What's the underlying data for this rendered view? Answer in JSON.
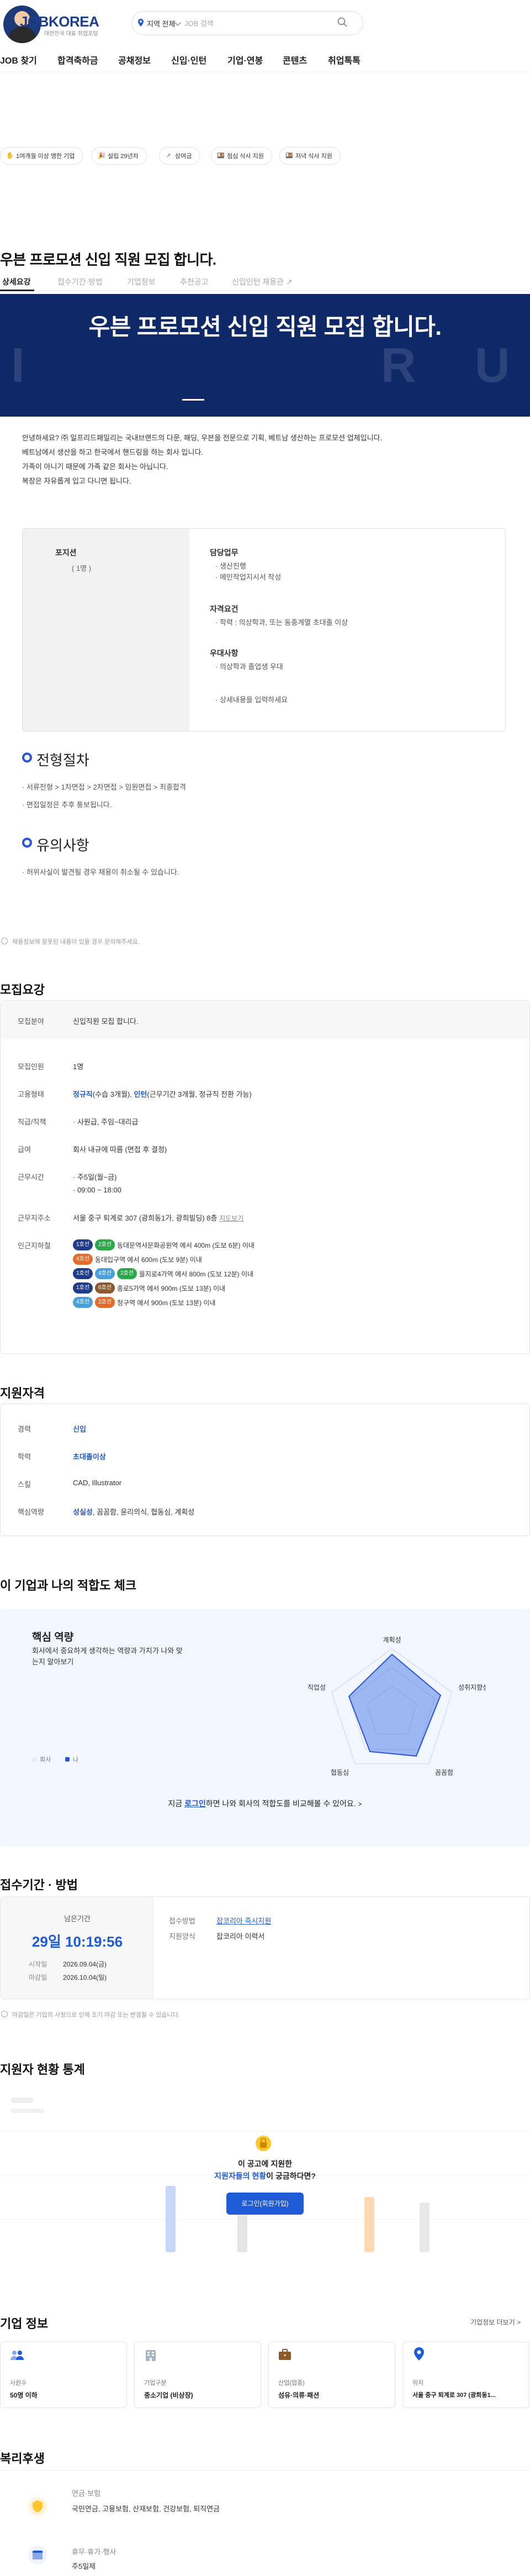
{
  "header": {
    "logo_text": "JOBKOREA",
    "logo_sub": "대한민국 대표 취업포털",
    "location_label": "지역 전체",
    "search_placeholder": "JOB 검색"
  },
  "nav": [
    {
      "label": "JOB 찾기"
    },
    {
      "label": "합격축하금"
    },
    {
      "label": "공채정보"
    },
    {
      "label": "신입·인턴"
    },
    {
      "label": "기업·연봉"
    },
    {
      "label": "콘텐츠"
    },
    {
      "label": "취업톡톡"
    }
  ],
  "chips": [
    {
      "icon": "✋",
      "label": "1여개월 이상 맹한 기업"
    },
    {
      "icon": "🎉",
      "label": "설립 29년차"
    },
    {
      "icon": "↗",
      "label": "상여금"
    },
    {
      "icon": "🍱",
      "label": "점심 식사 지원"
    },
    {
      "icon": "🍱",
      "label": "저녁 식사 지원"
    }
  ],
  "job": {
    "title": "우븐 프로모션 신입 직원 모집 합니다.",
    "tabs": [
      {
        "label": "상세요강"
      },
      {
        "label": "접수기간·방법"
      },
      {
        "label": "기업정보"
      },
      {
        "label": "추천공고"
      },
      {
        "label": "신입인턴 채용관 ↗"
      }
    ],
    "banner_title": "우븐 프로모션 신입 직원 모집 합니다.",
    "intro": [
      "안녕하세요? ㈜ 일프리드패밀리는 국내브랜드의 다운, 패딩, 우븐을 전문으로 기획, 베트남 생산하는 프로모션 업체입니다.",
      "베트남에서 생산을 하고 한국에서 핸드링을 하는 회사 입니다.",
      "가족이 아니기 때문에 가족 같은 회사는 아닙니다.",
      "복장은 자유롭게 입고 다니면 됩니다."
    ],
    "position": {
      "name": "포지션",
      "count": "( 1명 )",
      "sections": [
        {
          "heading": "담당업무",
          "items": [
            "생산진행",
            "메인작업지시서 작성"
          ]
        },
        {
          "heading": "자격요건",
          "items": [
            "학력 : 의상학과, 또는 동종계열 초대졸 이상"
          ]
        },
        {
          "heading": "우대사항",
          "items": [
            "의상학과 졸업생 우대"
          ]
        },
        {
          "heading": "",
          "items": [
            "상세내용을 입력하세요"
          ]
        }
      ]
    },
    "process_title": "전형절차",
    "process_lines": [
      "서류전형 > 1차면접 > 2차면접 > 임원면접 > 최종합격",
      "면접일정은 추후 통보됩니다."
    ],
    "caution_title": "유의사항",
    "caution_lines": [
      "허위사실이 발견될 경우 채용이 취소될 수 있습니다."
    ],
    "note": "채용정보에 잘못된 내용이 있을 경우 문의해주세요."
  },
  "recruit": {
    "title": "모집요강",
    "field_label": "모집분야",
    "field_value": "신입직원 모집 합니다.",
    "headcount_label": "모집인원",
    "headcount_value": "1명",
    "emp_label": "고용형태",
    "emp_value_1": "정규직",
    "emp_value_1_note": "(수습 3개월),",
    "emp_value_2": "인턴",
    "emp_value_2_note": "(근무기간 3개월, 정규직 전환 가능)",
    "rank_label": "직급/직책",
    "rank_value": "사원급, 주임~대리급",
    "salary_label": "급여",
    "salary_value": "회사 내규에 따름 (면접 후 결정)",
    "hours_label": "근무시간",
    "hours_value_1": "주5일(월~금)",
    "hours_value_2": "09:00 ~ 18:00",
    "address_label": "근무지주소",
    "address_value": "서울 중구 퇴계로 307 (광희동1가, 광희빌딩) 8층",
    "address_map": "지도보기",
    "station_label": "인근지하철",
    "stations": [
      {
        "badges": [
          {
            "t": "1호선",
            "c": "#1f3c8a"
          },
          {
            "t": "2호선",
            "c": "#2aa84a"
          }
        ],
        "text": "동대문역사문화공원역 에서 400m (도보 6분) 이내"
      },
      {
        "badges": [
          {
            "t": "4호선",
            "c": "#e36b2c"
          }
        ],
        "text": "동대입구역 에서 600m (도보 9분) 이내"
      },
      {
        "badges": [
          {
            "t": "1호선",
            "c": "#1f3c8a"
          },
          {
            "t": "4호선",
            "c": "#4aa0d8"
          },
          {
            "t": "2호선",
            "c": "#2aa84a"
          }
        ],
        "text": "을지로4가역 에서 800m (도보 12분) 이내"
      },
      {
        "badges": [
          {
            "t": "1호선",
            "c": "#1f3c8a"
          },
          {
            "t": "6호선",
            "c": "#8c5a2e"
          }
        ],
        "text": "종로5가역 에서 900m (도보 13분) 이내"
      },
      {
        "badges": [
          {
            "t": "4호선",
            "c": "#4aa0d8"
          },
          {
            "t": "2호선",
            "c": "#e36b2c"
          }
        ],
        "text": "청구역 에서 900m (도보 13분) 이내"
      }
    ]
  },
  "qual": {
    "title": "지원자격",
    "career_label": "경력",
    "career_value": "신입",
    "edu_label": "학력",
    "edu_value": "초대졸이상",
    "skill_label": "스킬",
    "skill_value": "CAD, Illustrator",
    "core_label": "핵심역량",
    "core_value_1": "성실성",
    "core_value_rest": ", 꼼꼼함, 윤리의식, 협동심, 계획성"
  },
  "fit": {
    "title": "이 기업과 나의 적합도 체크",
    "heading": "핵심 역량",
    "desc": "회사에서 중요하게 생각하는 역량과 가치가 나와 맞는지 알아보기",
    "axes": [
      "계획성",
      "성취지향성",
      "꼼꼼함",
      "협동심",
      "직업성"
    ],
    "company_label": "회사",
    "me_label": "나",
    "cta_pre": "지금",
    "cta_link": "로그인",
    "cta_post": "하면 나와 회사의 적합도를 비교해볼 수 있어요."
  },
  "apply": {
    "title": "접수기간 · 방법",
    "remain_label": "남은기간",
    "remain_value": "29일 10:19:56",
    "start_label": "시작일",
    "start_value": "2026.09.04(금)",
    "end_label": "마감일",
    "end_value": "2026.10.04(일)",
    "method_label": "접수방법",
    "method_value": "잡코리아 즉시지원",
    "form_label": "지원양식",
    "form_value": "잡코리아 이력서",
    "note": "마감일은 기업의 사정으로 인해 조기 마감 또는 변경될 수 있습니다."
  },
  "stats": {
    "title": "지원자 현황 통계",
    "overlay_line1": "이 공고에 지원한",
    "overlay_line2_blue": "지원자들의 현황",
    "overlay_line2_rest": "이 궁금하다면?",
    "overlay_button": "로그인(회원가입)"
  },
  "company": {
    "title": "기업 정보",
    "more": "기업정보 더보기 >",
    "cards": [
      {
        "icon": "people-icon",
        "k": "사원수",
        "v": "50명 이하"
      },
      {
        "icon": "building-icon",
        "k": "기업구분",
        "v": "중소기업 (비상장)"
      },
      {
        "icon": "briefcase-icon",
        "k": "산업(업종)",
        "v": "섬유·의류·패션"
      },
      {
        "icon": "location-icon",
        "k": "위치",
        "v": "서울 중구 퇴계로 307 (광희동1..."
      }
    ]
  },
  "welfare": {
    "title": "복리후생",
    "rows": [
      {
        "k": "연금·보험",
        "v": "국민연금, 고용보험, 산재보험, 건강보험, 퇴직연금"
      },
      {
        "k": "휴무·휴가·행사",
        "v": "주5일제"
      }
    ]
  },
  "colors": {
    "primary": "#1f5bd6",
    "banner": "#0f2868",
    "logo": "#1b3f8c"
  }
}
